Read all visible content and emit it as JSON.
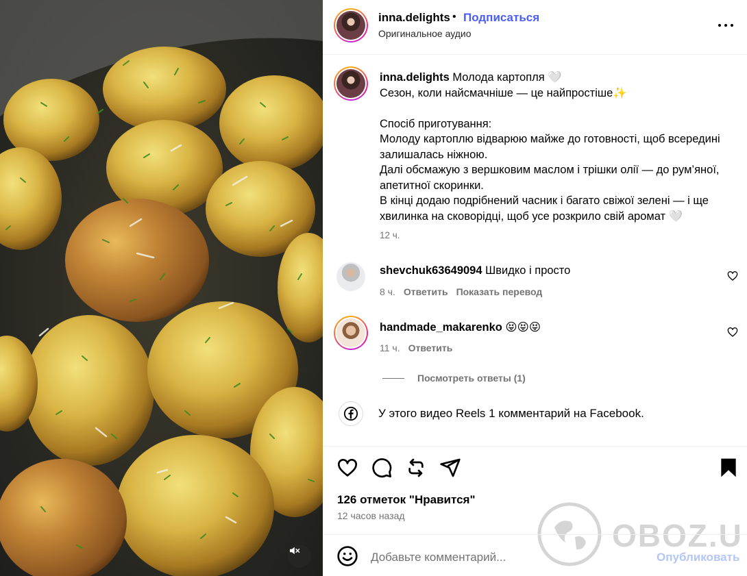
{
  "header": {
    "username": "inna.delights",
    "separator": "•",
    "follow_label": "Подписаться",
    "audio_label": "Оригинальное аудио",
    "more_icon": "more-horizontal-icon"
  },
  "caption": {
    "username": "inna.delights",
    "lines": [
      "Молода картопля 🤍",
      "Сезон, коли найсмачніше — це найпростіше✨",
      "",
      "Спосіб приготування:",
      "Молоду картоплю відварюю майже до готовності, щоб всередині залишалась ніжною.",
      "Далі обсмажую з вершковим маслом і трішки олії — до рум’яної, апетитної скоринки.",
      "В кінці додаю подрібнений часник і багато свіжої зелені — і ще хвилинка на сковорідці, щоб усе розкрило свій аромат 🤍"
    ],
    "time": "12 ч."
  },
  "comments": [
    {
      "username": "shevchuk63649094",
      "text": "Швидко і просто",
      "time": "8 ч.",
      "reply_label": "Ответить",
      "translate_label": "Показать перевод"
    },
    {
      "username": "handmade_makarenko",
      "text": "😝😝😝",
      "time": "11 ч.",
      "reply_label": "Ответить",
      "view_replies_label": "Посмотреть ответы (1)"
    }
  ],
  "facebook_note": "У этого видео Reels 1 комментарий на Facebook.",
  "actions": {
    "icons": [
      "heart-icon",
      "comment-icon",
      "repost-icon",
      "share-icon",
      "bookmark-icon"
    ]
  },
  "likes_text": "126 отметок \"Нравится\"",
  "post_time": "12 часов назад",
  "comment_box": {
    "placeholder": "Добавьте комментарий...",
    "publish_label": "Опубликовать"
  },
  "watermark": "OBOZ.UA",
  "colors": {
    "accent_blue": "#4a5df9",
    "publish_disabled": "#b3c6f7",
    "secondary_text": "#737373",
    "divider": "#efefef"
  }
}
